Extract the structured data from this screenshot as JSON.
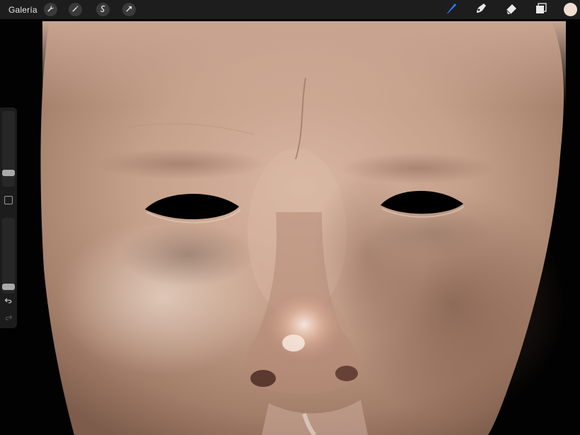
{
  "topbar": {
    "gallery_label": "Galería",
    "left_tools": [
      "wrench-icon",
      "magic-wand-icon",
      "selection-icon",
      "transform-arrow-icon"
    ],
    "right_tools": [
      "brush-icon",
      "smudge-icon",
      "eraser-icon",
      "layers-icon"
    ],
    "active_tool": "brush-icon",
    "active_color": "#f1dcd0",
    "accent_color": "#2f7fff"
  },
  "sidebar": {
    "brush_size_level": 0.15,
    "opacity_level": 0.05,
    "tools": [
      "modify-button",
      "undo-icon",
      "redo-icon"
    ]
  }
}
